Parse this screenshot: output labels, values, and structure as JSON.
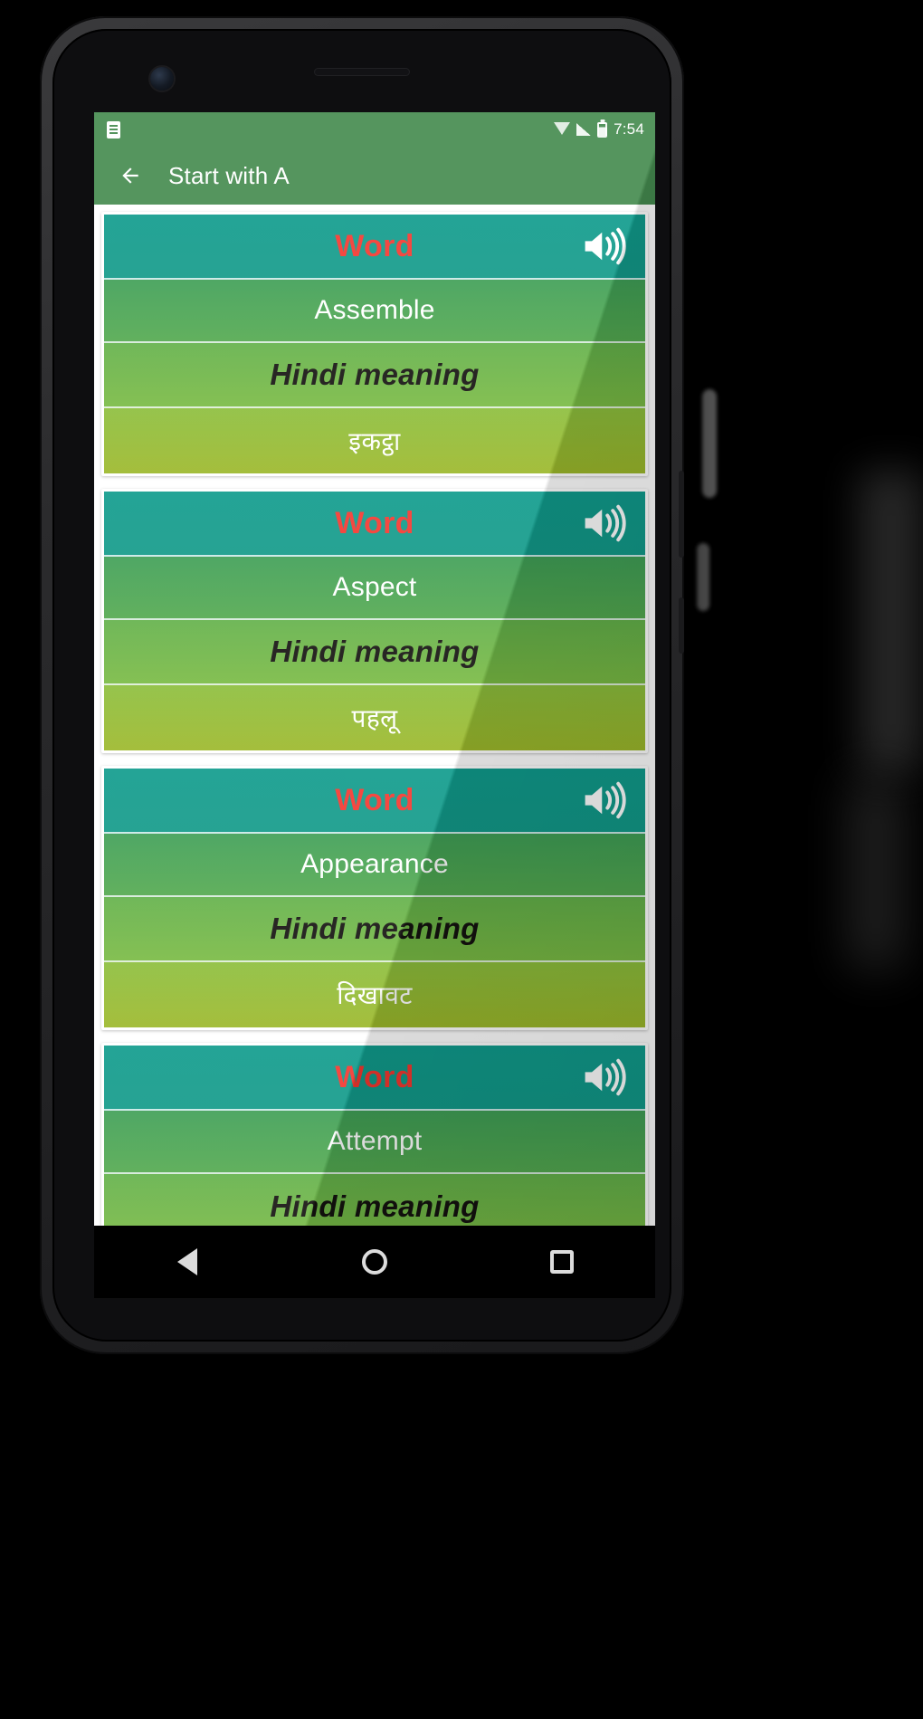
{
  "device": {
    "platform": "android",
    "icons": {
      "camera": "front-camera",
      "earpiece": "earpiece-speaker-icon"
    }
  },
  "status_bar": {
    "background_color": "#458b4f",
    "time": "7:54",
    "left_icons": [
      {
        "name": "notification-icon",
        "glyph": "note"
      }
    ],
    "right_icons": [
      {
        "name": "wifi-icon",
        "glyph": "wifi"
      },
      {
        "name": "signal-icon",
        "glyph": "signal"
      },
      {
        "name": "battery-icon",
        "glyph": "battery"
      }
    ]
  },
  "app_bar": {
    "background_color": "#458b4f",
    "back_label": "back-arrow",
    "title": "Start with A"
  },
  "theme": {
    "word_row_color": "#11998e",
    "english_row_color": "#49a452",
    "hindi_meaning_row_color": "#6fb646",
    "hindi_word_row_color": "#93bb33",
    "word_label_color": "#f4372f",
    "english_text_color": "#ffffff",
    "hindi_meaning_text_color": "#14120f",
    "hindi_word_text_color": "#ffffff"
  },
  "labels": {
    "word_heading": "Word",
    "hindi_meaning_heading": "Hindi meaning",
    "speaker_icon": "speaker-icon"
  },
  "cards": [
    {
      "word_heading": "Word",
      "english": "Assemble",
      "hindi_meaning_heading": "Hindi meaning",
      "hindi": "इकट्ठा"
    },
    {
      "word_heading": "Word",
      "english": "Aspect",
      "hindi_meaning_heading": "Hindi meaning",
      "hindi": "पहलू"
    },
    {
      "word_heading": "Word",
      "english": "Appearance",
      "hindi_meaning_heading": "Hindi meaning",
      "hindi": "दिखावट"
    },
    {
      "word_heading": "Word",
      "english": "Attempt",
      "hindi_meaning_heading": "Hindi meaning",
      "hindi": ""
    }
  ],
  "nav_bar": {
    "background_color": "#000000",
    "buttons": [
      {
        "name": "nav-back-button",
        "glyph": "triangle-left"
      },
      {
        "name": "nav-home-button",
        "glyph": "circle"
      },
      {
        "name": "nav-recents-button",
        "glyph": "square"
      }
    ]
  }
}
